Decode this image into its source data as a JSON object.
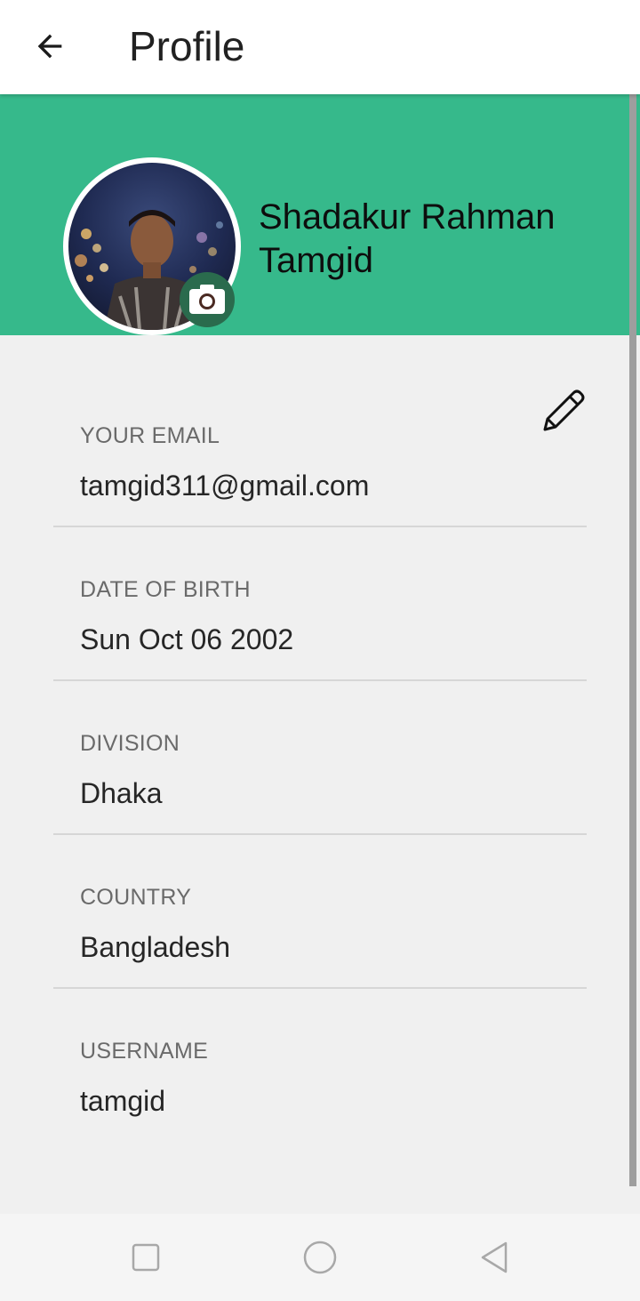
{
  "appbar": {
    "title": "Profile",
    "back_icon": "arrow-left-icon"
  },
  "header": {
    "background_color": "#36b98b",
    "name": "Shadakur Rahman Tamgid",
    "avatar_icon": "profile-photo",
    "camera_icon": "camera-icon"
  },
  "edit_icon": "pencil-icon",
  "fields": [
    {
      "label": "YOUR EMAIL",
      "value": "tamgid311@gmail.com"
    },
    {
      "label": "DATE OF BIRTH",
      "value": "Sun Oct 06 2002"
    },
    {
      "label": "DIVISION",
      "value": "Dhaka"
    },
    {
      "label": "COUNTRY",
      "value": "Bangladesh"
    },
    {
      "label": "USERNAME",
      "value": "tamgid"
    }
  ],
  "navbar": {
    "recents_icon": "square-icon",
    "home_icon": "circle-icon",
    "back_icon": "triangle-back-icon"
  }
}
